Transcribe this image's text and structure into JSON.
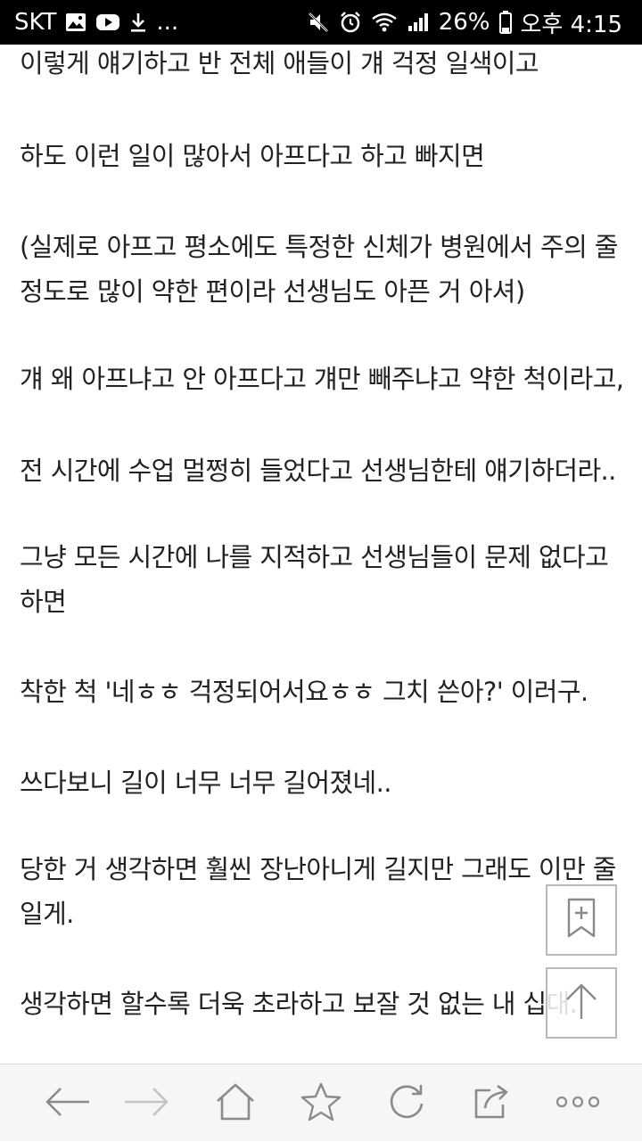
{
  "status_bar": {
    "carrier": "SKT",
    "left_icons": [
      "gallery-icon",
      "youtube-icon",
      "download-icon"
    ],
    "overflow": "...",
    "right_icons": [
      "mute-icon",
      "alarm-icon",
      "wifi-icon",
      "signal-icon"
    ],
    "battery_percent": "26%",
    "battery_level": 0.26,
    "time": "오후 4:15"
  },
  "article": {
    "paragraphs": [
      [
        "이렇게 얘기하고 반 전체 애들이 걔 걱정 일색이고"
      ],
      [
        "하도 이런 일이 많아서 아프다고 하고 빠지면"
      ],
      [
        "(실제로 아프고 평소에도 특정한 신체가 병원에서 주의 줄",
        "정도로 많이 약한 편이라 선생님도 아픈 거 아셔)"
      ],
      [
        "걔 왜 아프냐고 안 아프다고 걔만 빼주냐고 약한 척이라고,"
      ],
      [
        "전 시간에 수업 멀쩡히 들었다고 선생님한테 얘기하더라.."
      ],
      [
        "그냥 모든 시간에 나를 지적하고 선생님들이 문제 없다고",
        "하면"
      ],
      [
        "착한 척 '네ㅎㅎ 걱정되어서요ㅎㅎ 그치 쓴아?' 이러구."
      ],
      [
        "쓰다보니 길이 너무 너무 길어졌네.."
      ],
      [
        "당한 거 생각하면 훨씬 장난아니게 길지만 그래도 이만 줄",
        "일게."
      ],
      [
        "생각하면 할수록 더욱 초라하고 보잘 것 없는 내 십대."
      ]
    ]
  },
  "floating_buttons": {
    "bookmark_add": "bookmark-add-icon",
    "scroll_top": "arrow-up-icon"
  },
  "bottom_nav": {
    "items": [
      "back-arrow-icon",
      "forward-arrow-icon",
      "home-icon",
      "star-icon",
      "refresh-icon",
      "share-icon",
      "more-icon"
    ]
  },
  "colors": {
    "status_bg": "#000000",
    "text": "#222222",
    "bottom_bar_bg": "#f6f6f8",
    "icon_gray": "#8a8a8e"
  }
}
